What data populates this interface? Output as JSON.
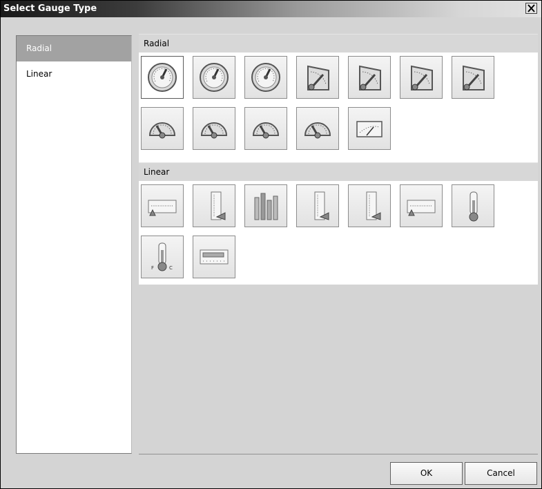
{
  "window": {
    "title": "Select Gauge Type",
    "close_glyph": "✕"
  },
  "sidebar": {
    "items": [
      {
        "label": "Radial",
        "selected": true
      },
      {
        "label": "Linear",
        "selected": false
      }
    ]
  },
  "sections": [
    {
      "header": "Radial",
      "tiles": [
        "radial-full-gauge-icon",
        "radial-full-gauge-icon",
        "radial-full-gauge-icon",
        "radial-quarter-gauge-icon",
        "radial-quarter-gauge-icon",
        "radial-quarter-gauge-icon",
        "radial-quarter-gauge-icon",
        "radial-half-gauge-icon",
        "radial-half-gauge-icon",
        "radial-half-gauge-icon",
        "radial-half-gauge-icon",
        "radial-meter-gauge-icon"
      ]
    },
    {
      "header": "Linear",
      "tiles": [
        "linear-horizontal-gauge-icon",
        "linear-vertical-gauge-icon",
        "linear-multibar-gauge-icon",
        "linear-vertical-gauge-icon",
        "linear-vertical-gauge-icon",
        "linear-horizontal-gauge-icon",
        "thermometer-gauge-icon",
        "thermometer-fc-gauge-icon",
        "linear-bar-gauge-icon"
      ]
    }
  ],
  "buttons": {
    "ok": "OK",
    "cancel": "Cancel"
  },
  "colors": {
    "selected_item": "#a2a2a2",
    "section_header": "#d7d7d7",
    "panel_bg": "#d4d4d4"
  }
}
